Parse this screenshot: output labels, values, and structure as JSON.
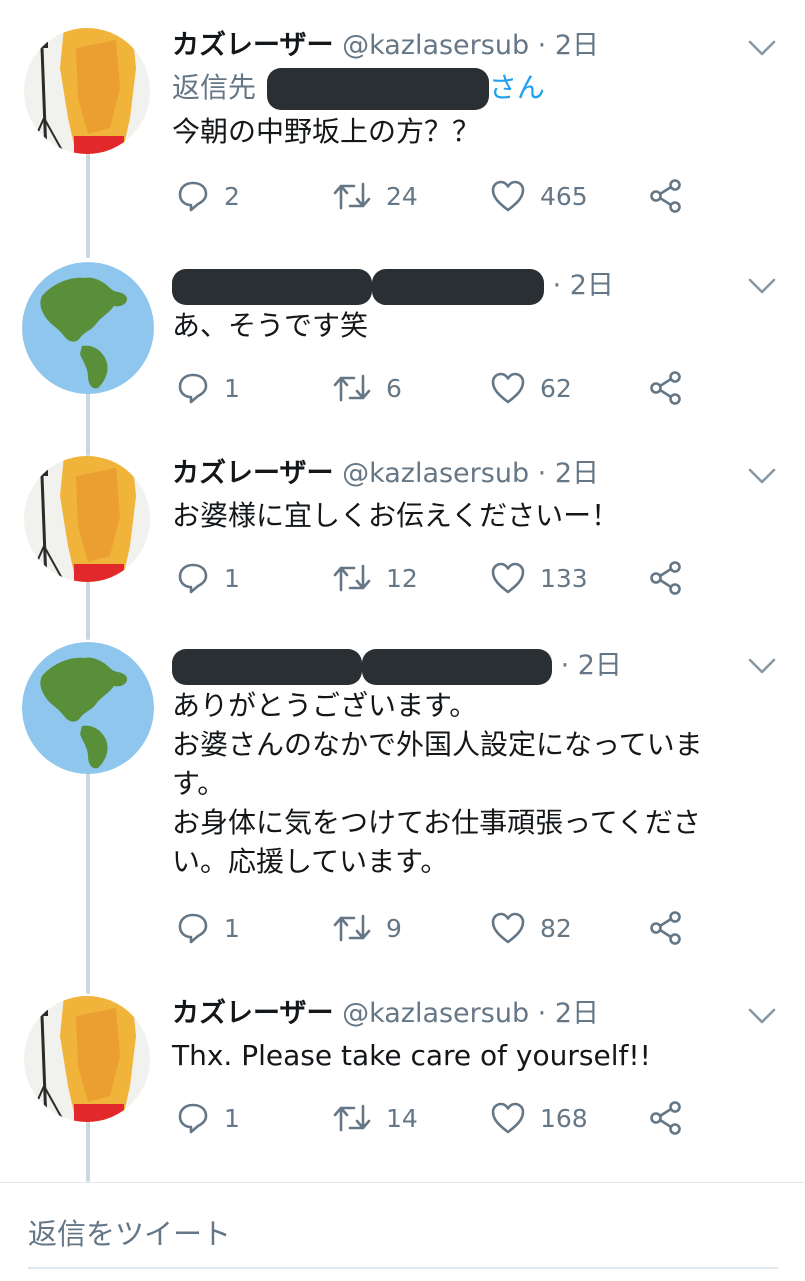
{
  "tweets": [
    {
      "author": "カズレーザー",
      "handle": "@kazlasersub",
      "sep": " · ",
      "time": "2日",
      "reply_prefix": "返信先",
      "reply_suffix": "さん",
      "text": "今朝の中野坂上の方？？",
      "replies": "2",
      "retweets": "24",
      "likes": "465",
      "avatar": "person-avatar"
    },
    {
      "author": "",
      "handle": "",
      "sep": " · ",
      "time": "2日",
      "text": "あ、そうです笑",
      "replies": "1",
      "retweets": "6",
      "likes": "62",
      "avatar": "globe-avatar"
    },
    {
      "author": "カズレーザー",
      "handle": "@kazlasersub",
      "sep": " · ",
      "time": "2日",
      "text": "お婆様に宜しくお伝えくださいー！",
      "replies": "1",
      "retweets": "12",
      "likes": "133",
      "avatar": "person-avatar"
    },
    {
      "author": "",
      "handle": "",
      "sep": " · ",
      "time": "2日",
      "text": "ありがとうございます。\nお婆さんのなかで外国人設定になっていま\nす。\nお身体に気をつけてお仕事頑張ってくださ\nい。応援しています。",
      "replies": "1",
      "retweets": "9",
      "likes": "82",
      "avatar": "globe-avatar"
    },
    {
      "author": "カズレーザー",
      "handle": "@kazlasersub",
      "sep": " · ",
      "time": "2日",
      "text": "Thx. Please take care of yourself!!",
      "replies": "1",
      "retweets": "14",
      "likes": "168",
      "avatar": "person-avatar"
    }
  ],
  "reply_box": {
    "placeholder": "返信をツイート"
  },
  "colors": {
    "muted": "#657786",
    "link": "#1da1f2",
    "thread_line": "#ccd6dd",
    "redaction": "#2a2f33"
  },
  "icons": [
    "reply-icon",
    "retweet-icon",
    "like-icon",
    "share-icon",
    "chevron-down-icon"
  ]
}
